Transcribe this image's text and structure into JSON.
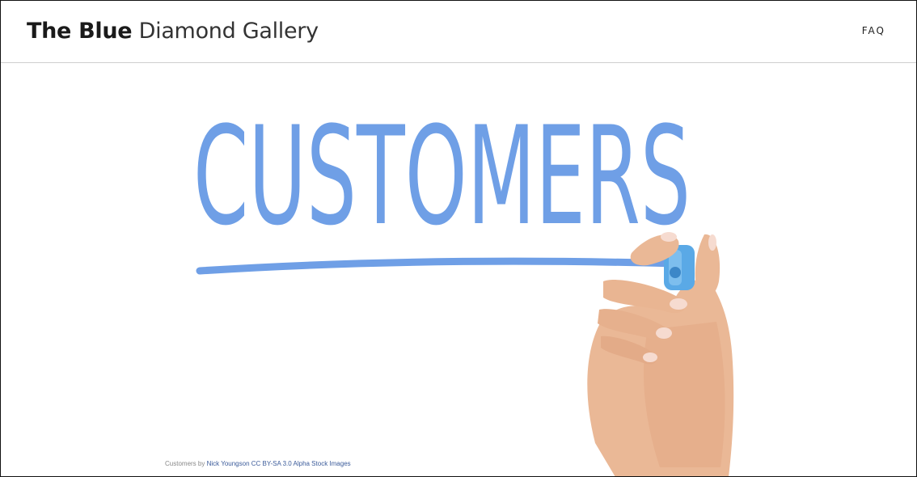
{
  "header": {
    "brand_strong": "The Blue",
    "brand_light": "Diamond Gallery",
    "nav_faq": "FAQ"
  },
  "image": {
    "word": "CUSTOMERS",
    "ink_color": "#6f9fe6",
    "marker_color": "#5aa9e6"
  },
  "credit": {
    "prefix": "Customers by",
    "author": "Nick Youngson",
    "license": "CC BY-SA 3.0",
    "source": "Alpha Stock Images"
  }
}
